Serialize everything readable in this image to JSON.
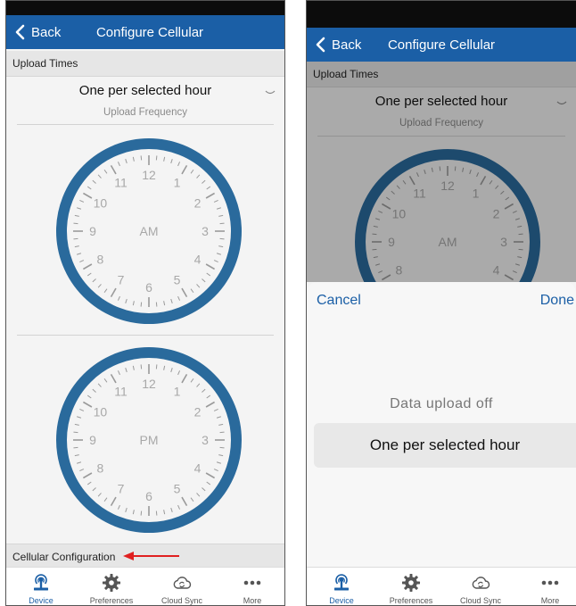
{
  "nav": {
    "back": "Back",
    "title": "Configure Cellular"
  },
  "sections": {
    "upload_times": "Upload Times",
    "cellular_configuration": "Cellular Configuration"
  },
  "frequency": {
    "value": "One per selected hour",
    "label": "Upload Frequency"
  },
  "clocks": {
    "am_label": "AM",
    "pm_label": "PM",
    "numbers": [
      "12",
      "1",
      "2",
      "3",
      "4",
      "5",
      "6",
      "7",
      "8",
      "9",
      "10",
      "11"
    ]
  },
  "picker": {
    "cancel": "Cancel",
    "done": "Done",
    "options": [
      "Data upload off",
      "One per selected hour"
    ],
    "selected": "One per selected hour"
  },
  "tabs": [
    {
      "label": "Device",
      "icon": "device-icon",
      "active": true
    },
    {
      "label": "Preferences",
      "icon": "gear-icon"
    },
    {
      "label": "Cloud Sync",
      "icon": "cloud-sync-icon"
    },
    {
      "label": "More",
      "icon": "more-icon"
    }
  ],
  "colors": {
    "accent": "#1b5fa6",
    "clock_ring": "#2a6a9c",
    "arrow": "#e02020"
  }
}
